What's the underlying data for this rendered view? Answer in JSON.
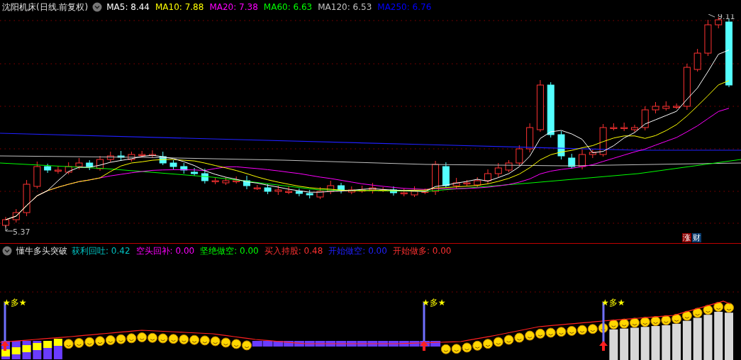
{
  "price_header": {
    "stock": "沈阳机床(日线.前复权)",
    "indicators": [
      {
        "label": "MA5: 8.44",
        "color": "#ffffff"
      },
      {
        "label": "MA10: 7.88",
        "color": "#ffff00"
      },
      {
        "label": "MA20: 7.38",
        "color": "#ff00ff"
      },
      {
        "label": "MA60: 6.63",
        "color": "#00ff00"
      },
      {
        "label": "MA120: 6.53",
        "color": "#c0c0c0"
      },
      {
        "label": "MA250: 6.76",
        "color": "#0000ff"
      }
    ]
  },
  "price_chart": {
    "high_label": "9.11",
    "low_label": "5.37",
    "badges": [
      {
        "text": "涨",
        "color": "#8b0000"
      },
      {
        "text": "财",
        "color": "#0b3c6e"
      }
    ]
  },
  "indicator_header": {
    "name": "懂牛多头突破",
    "values": [
      {
        "label": "获利回吐: 0.42",
        "color": "#00c0c0"
      },
      {
        "label": "空头回补: 0.00",
        "color": "#ff00ff"
      },
      {
        "label": "坚绝做空: 0.00",
        "color": "#00ff00"
      },
      {
        "label": "买入持股: 0.48",
        "color": "#ff3030"
      },
      {
        "label": "开始做空: 0.00",
        "color": "#2020ff"
      },
      {
        "label": "开始做多: 0.00",
        "color": "#ff3030"
      }
    ]
  },
  "signals": [
    {
      "text": "★多★"
    },
    {
      "text": "★多★"
    },
    {
      "text": "★多★"
    }
  ]
}
